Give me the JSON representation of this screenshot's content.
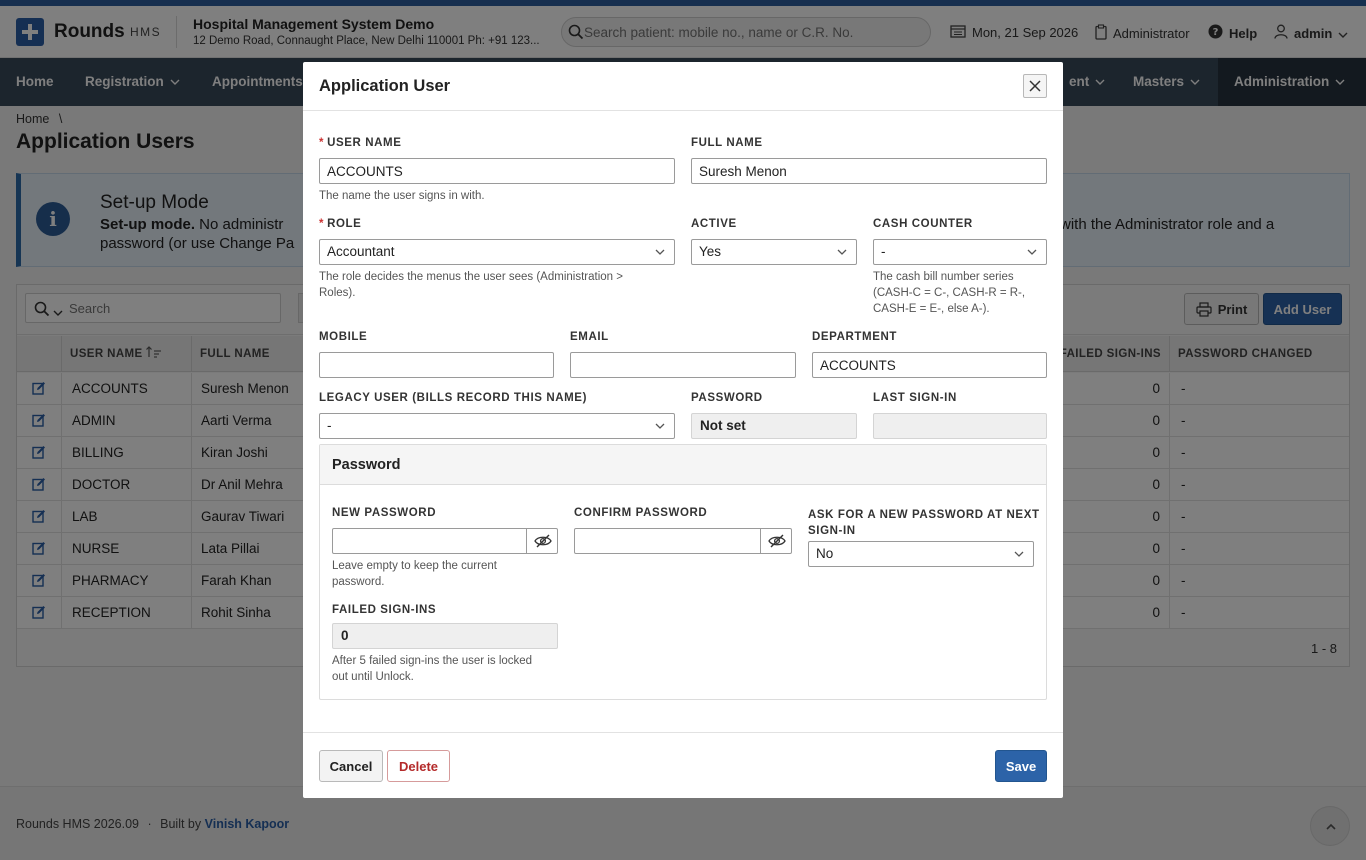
{
  "header": {
    "brand": "Rounds",
    "brand_sub": "HMS",
    "hospital_name": "Hospital Management System Demo",
    "hospital_address": "12 Demo Road, Connaught Place, New Delhi 110001 Ph: +91 123...",
    "search_placeholder": "Search patient: mobile no., name or C.R. No.",
    "date": "Mon, 21 Sep 2026",
    "role": "Administrator",
    "help": "Help",
    "user": "admin"
  },
  "nav": {
    "home": "Home",
    "registration": "Registration",
    "appointments": "Appointments",
    "hidden_tail": "ent",
    "masters": "Masters",
    "administration": "Administration"
  },
  "page": {
    "breadcrumb": "Home",
    "breadcrumb_sep": "\\",
    "title": "Application Users",
    "alert_title": "Set-up Mode",
    "alert_bold": "Set-up mode.",
    "alert_text_left": " No administr",
    "alert_text_right": "with the Administrator role and a",
    "alert_text_line2": "password (or use Change Pa"
  },
  "grid": {
    "search_placeholder": "Search",
    "print_label": "Print",
    "add_label": "Add User",
    "columns": {
      "user_name": "USER NAME",
      "full_name": "FULL NAME",
      "failed_signins": "FAILED SIGN-INS",
      "password_changed": "PASSWORD CHANGED"
    },
    "rows": [
      {
        "user": "ACCOUNTS",
        "full": "Suresh Menon",
        "failed": "0",
        "pw": "-"
      },
      {
        "user": "ADMIN",
        "full": "Aarti Verma",
        "failed": "0",
        "pw": "-"
      },
      {
        "user": "BILLING",
        "full": "Kiran Joshi",
        "failed": "0",
        "pw": "-"
      },
      {
        "user": "DOCTOR",
        "full": "Dr Anil Mehra",
        "failed": "0",
        "pw": "-"
      },
      {
        "user": "LAB",
        "full": "Gaurav Tiwari",
        "failed": "0",
        "pw": "-"
      },
      {
        "user": "NURSE",
        "full": "Lata Pillai",
        "failed": "0",
        "pw": "-"
      },
      {
        "user": "PHARMACY",
        "full": "Farah Khan",
        "failed": "0",
        "pw": "-"
      },
      {
        "user": "RECEPTION",
        "full": "Rohit Sinha",
        "failed": "0",
        "pw": "-"
      }
    ],
    "count": "1 - 8"
  },
  "footer": {
    "version": "Rounds HMS 2026.09",
    "sep": "·",
    "built_by": "Built by",
    "author": "Vinish Kapoor"
  },
  "modal": {
    "title": "Application User",
    "user_name_label": "USER NAME",
    "user_name_value": "ACCOUNTS",
    "user_name_help": "The name the user signs in with.",
    "full_name_label": "FULL NAME",
    "full_name_value": "Suresh Menon",
    "role_label": "ROLE",
    "role_value": "Accountant",
    "role_help": "The role decides the menus the user sees (Administration > Roles).",
    "active_label": "ACTIVE",
    "active_value": "Yes",
    "cash_counter_label": "CASH COUNTER",
    "cash_counter_value": "-",
    "cash_counter_help": "The cash bill number series (CASH-C = C-, CASH-R = R-, CASH-E = E-, else A-).",
    "mobile_label": "MOBILE",
    "mobile_value": "",
    "email_label": "EMAIL",
    "email_value": "",
    "department_label": "DEPARTMENT",
    "department_value": "ACCOUNTS",
    "legacy_label": "LEGACY USER (BILLS RECORD THIS NAME)",
    "legacy_value": "-",
    "password_label": "PASSWORD",
    "password_value": "Not set",
    "last_signin_label": "LAST SIGN-IN",
    "last_signin_value": "",
    "pw_panel_title": "Password",
    "new_pw_label": "NEW PASSWORD",
    "new_pw_help": "Leave empty to keep the current password.",
    "confirm_pw_label": "CONFIRM PASSWORD",
    "ask_new_pw_label_1": "ASK FOR A NEW PASSWORD AT NEXT",
    "ask_new_pw_label_2": "SIGN-IN",
    "ask_new_pw_value": "No",
    "failed_label": "FAILED SIGN-INS",
    "failed_value": "0",
    "failed_help": "After 5 failed sign-ins the user is locked out until Unlock.",
    "cancel_label": "Cancel",
    "delete_label": "Delete",
    "save_label": "Save"
  }
}
